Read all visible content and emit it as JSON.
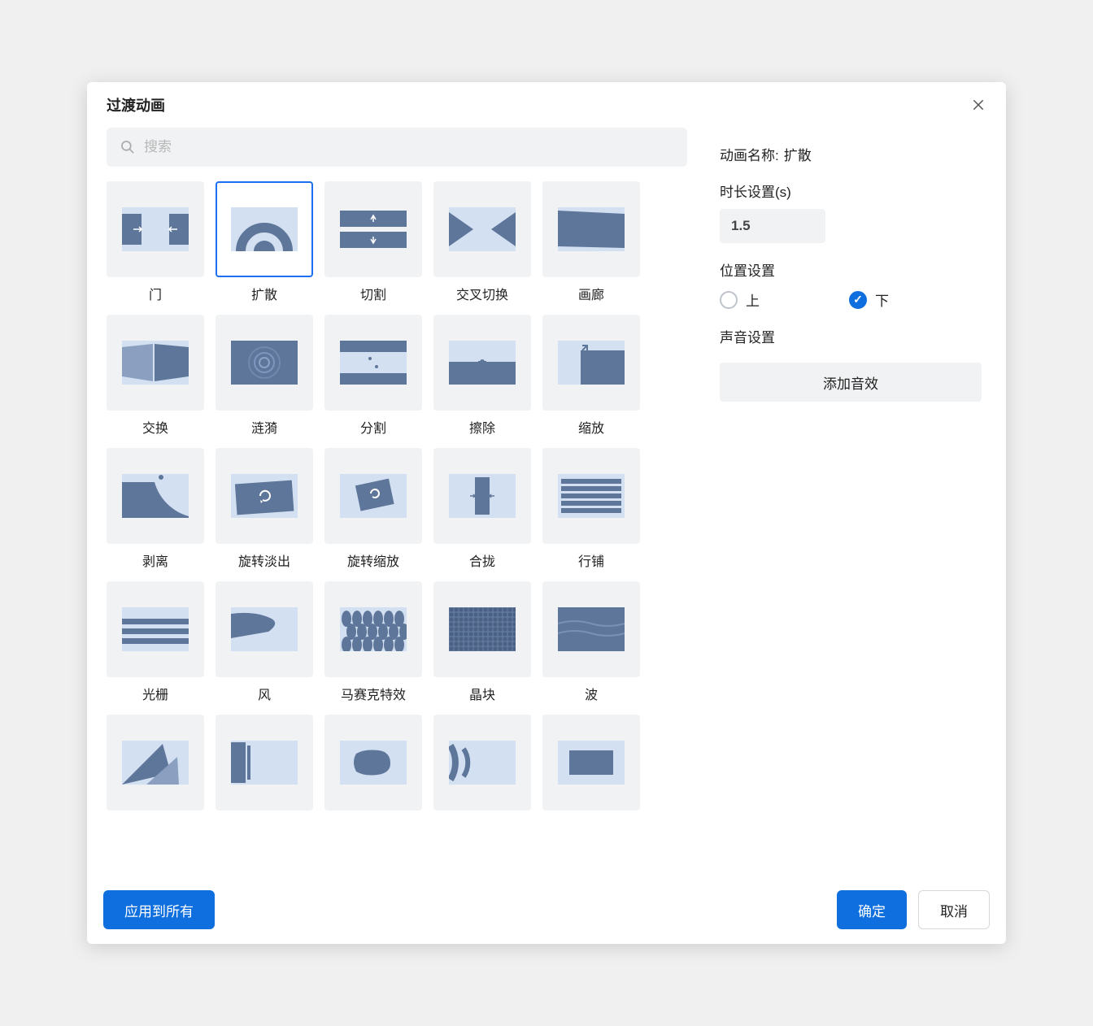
{
  "dialog": {
    "title": "过渡动画",
    "search_placeholder": "搜索"
  },
  "transitions": [
    {
      "id": "door",
      "label": "门"
    },
    {
      "id": "spread",
      "label": "扩散",
      "selected": true
    },
    {
      "id": "cut",
      "label": "切割"
    },
    {
      "id": "cross",
      "label": "交叉切换"
    },
    {
      "id": "gallery",
      "label": "画廊"
    },
    {
      "id": "swap",
      "label": "交换"
    },
    {
      "id": "ripple",
      "label": "涟漪"
    },
    {
      "id": "split",
      "label": "分割"
    },
    {
      "id": "wipe",
      "label": "擦除"
    },
    {
      "id": "zoom",
      "label": "缩放"
    },
    {
      "id": "peel",
      "label": "剥离"
    },
    {
      "id": "rotatefade",
      "label": "旋转淡出"
    },
    {
      "id": "rotatezoom",
      "label": "旋转缩放"
    },
    {
      "id": "merge",
      "label": "合拢"
    },
    {
      "id": "stripes",
      "label": "行铺"
    },
    {
      "id": "raster",
      "label": "光栅"
    },
    {
      "id": "wind",
      "label": "风"
    },
    {
      "id": "mosaic",
      "label": "马赛克特效"
    },
    {
      "id": "crystal",
      "label": "晶块"
    },
    {
      "id": "wave",
      "label": "波"
    },
    {
      "id": "tri",
      "label": ""
    },
    {
      "id": "slide",
      "label": ""
    },
    {
      "id": "blob",
      "label": ""
    },
    {
      "id": "arcs",
      "label": ""
    },
    {
      "id": "rect",
      "label": ""
    }
  ],
  "settings": {
    "name_label": "动画名称:",
    "name_value": "扩散",
    "duration_label": "时长设置(s)",
    "duration_value": "1.5",
    "position_label": "位置设置",
    "position_options": {
      "up": "上",
      "down": "下"
    },
    "position_selected": "down",
    "sound_label": "声音设置",
    "add_sound": "添加音效"
  },
  "footer": {
    "apply_all": "应用到所有",
    "ok": "确定",
    "cancel": "取消"
  }
}
